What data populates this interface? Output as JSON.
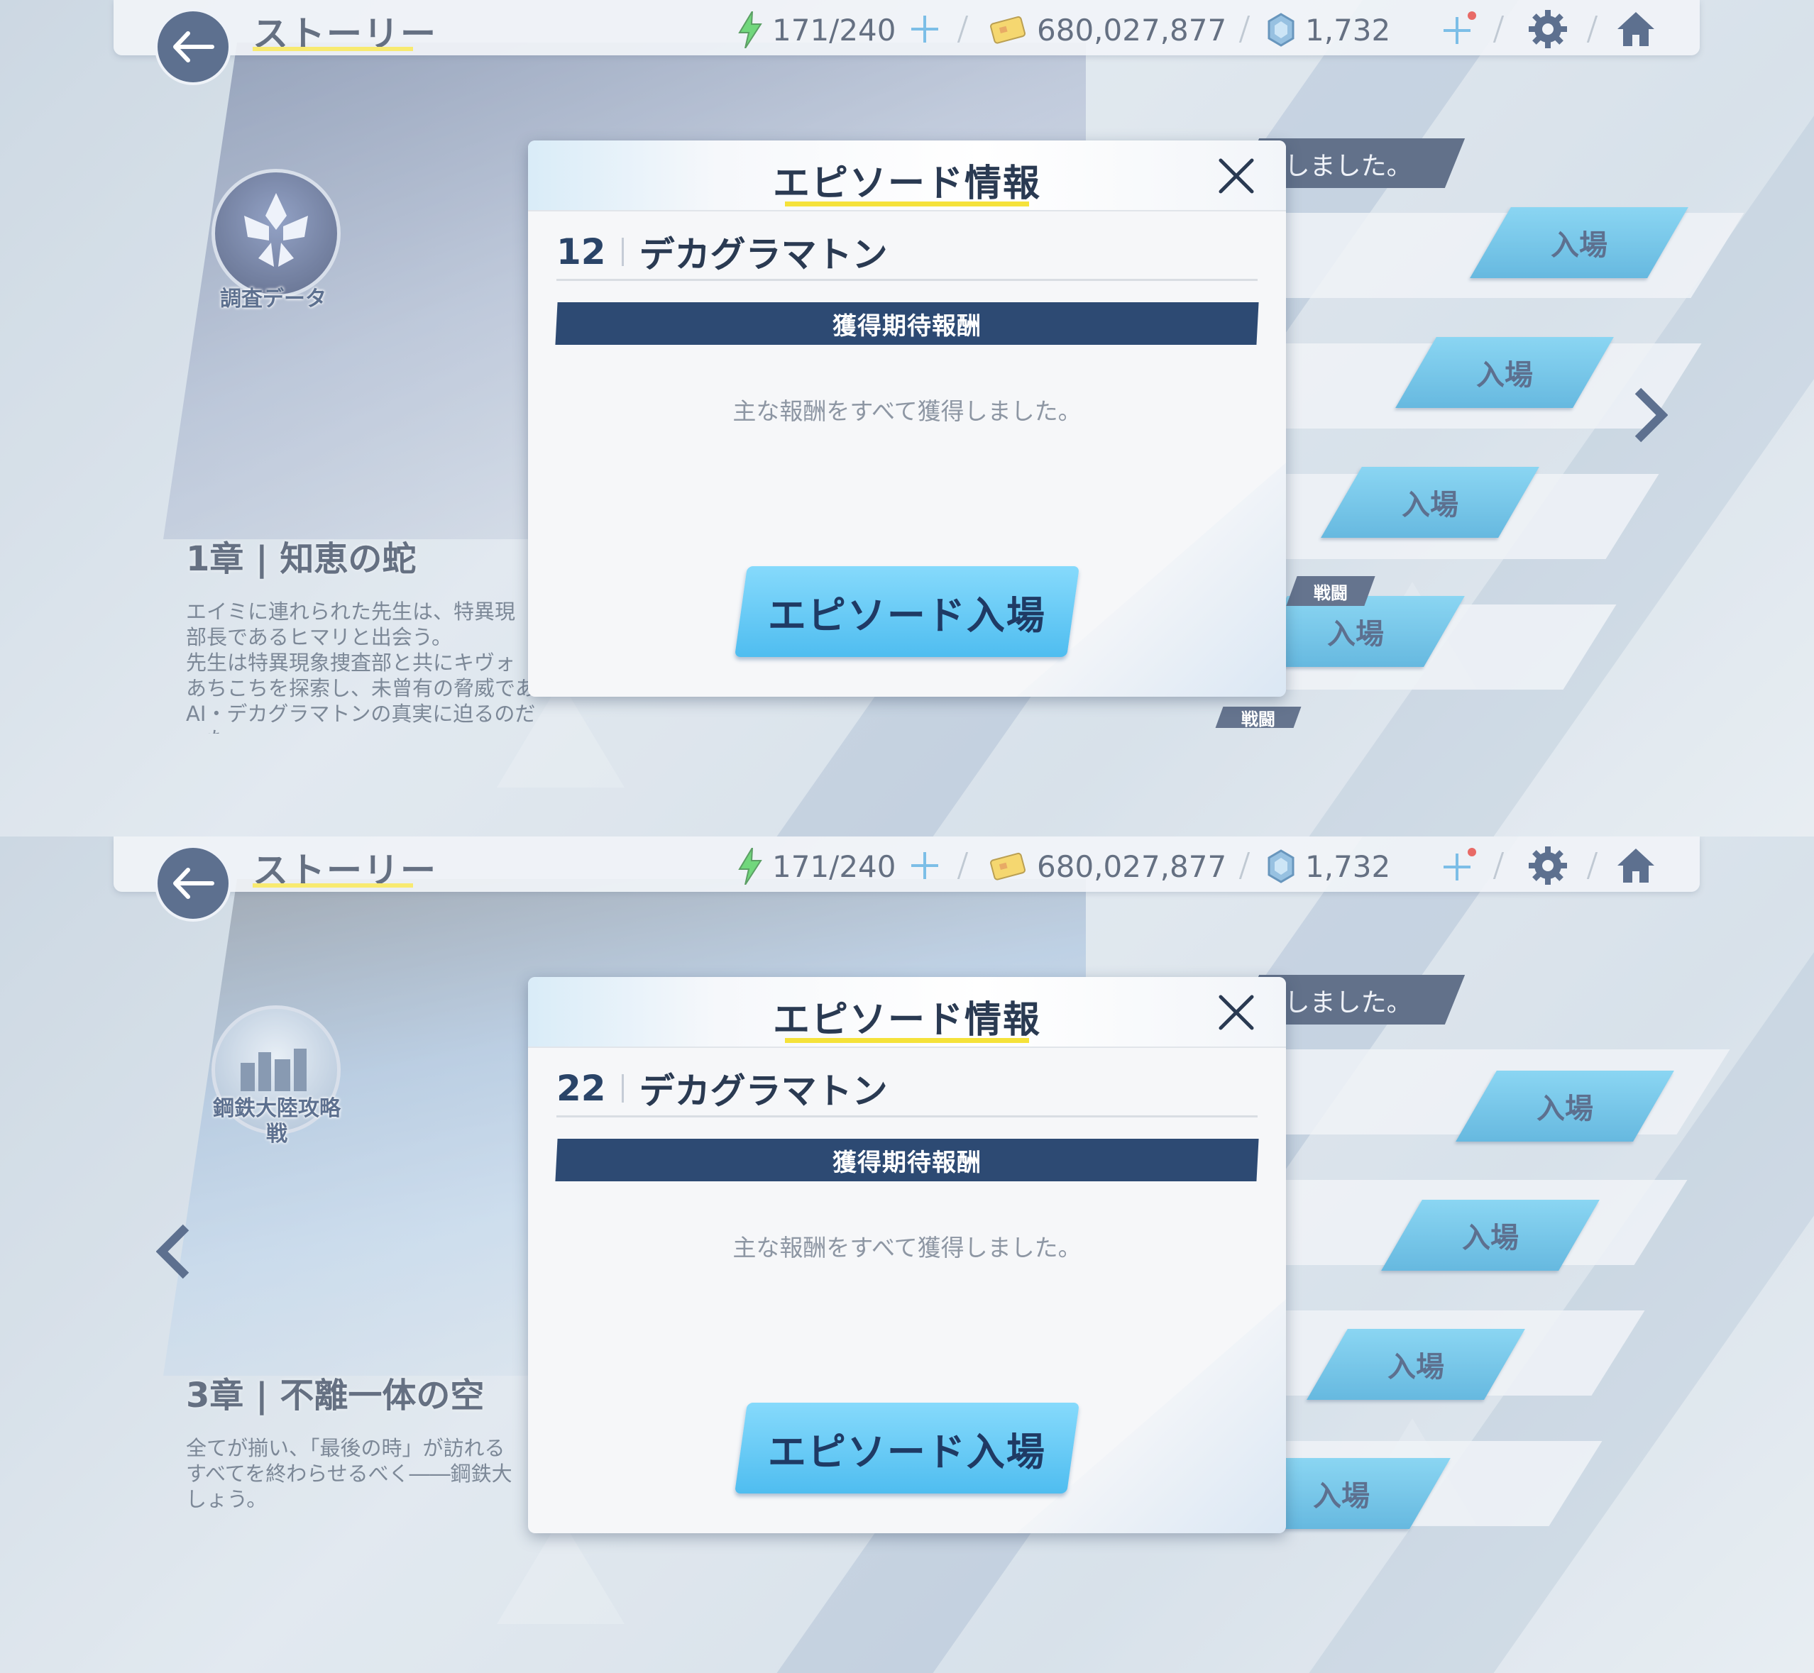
{
  "screens": [
    {
      "header": {
        "title": "ストーリー",
        "stamina": "171/240",
        "credits": "680,027,877",
        "gems": "1,732"
      },
      "chapter": {
        "emblem_label": "調査データ",
        "title": "1章 | 知恵の蛇",
        "description": "エイミに連れられた先生は、特異現\n部長であるヒマリと出会う。\n先生は特異現象捜査部と共にキヴォ\nあちこちを探索し、未曾有の脅威であ\nAI・デカグラマトンの真実に迫るのだった。"
      },
      "notice_banner": "しました。",
      "enter_buttons": [
        "入場",
        "入場",
        "入場",
        "入場"
      ],
      "battle_tags": [
        "戦闘",
        "戦闘"
      ],
      "modal": {
        "title": "エピソード情報",
        "episode_number": "12",
        "episode_name": "デカグラマトン",
        "reward_header": "獲得期待報酬",
        "reward_message": "主な報酬をすべて獲得しました。",
        "enter_button": "エピソード入場"
      }
    },
    {
      "header": {
        "title": "ストーリー",
        "stamina": "171/240",
        "credits": "680,027,877",
        "gems": "1,732"
      },
      "chapter": {
        "emblem_label": "鋼鉄大陸攻略戦",
        "title": "3章 | 不離一体の空",
        "description": "全てが揃い、「最後の時」が訪れる\nすべてを終わらせるべく――鋼鉄大\nしょう。"
      },
      "notice_banner": "しました。",
      "enter_buttons": [
        "入場",
        "入場",
        "入場",
        "入場"
      ],
      "battle_tags": [],
      "modal": {
        "title": "エピソード情報",
        "episode_number": "22",
        "episode_name": "デカグラマトン",
        "reward_header": "獲得期待報酬",
        "reward_message": "主な報酬をすべて獲得しました。",
        "enter_button": "エピソード入場"
      }
    }
  ],
  "colors": {
    "navy": "#1f3a64",
    "accent_yellow": "#f5e23a",
    "enter_blue": "#4fbdf0",
    "reward_bar": "#2d4a73"
  },
  "icons": [
    "back-arrow-icon",
    "stamina-bolt-icon",
    "credit-card-icon",
    "gem-icon",
    "plus-icon",
    "gear-icon",
    "home-icon",
    "close-icon",
    "chevron-right-icon",
    "chevron-left-icon",
    "sword-icon"
  ]
}
